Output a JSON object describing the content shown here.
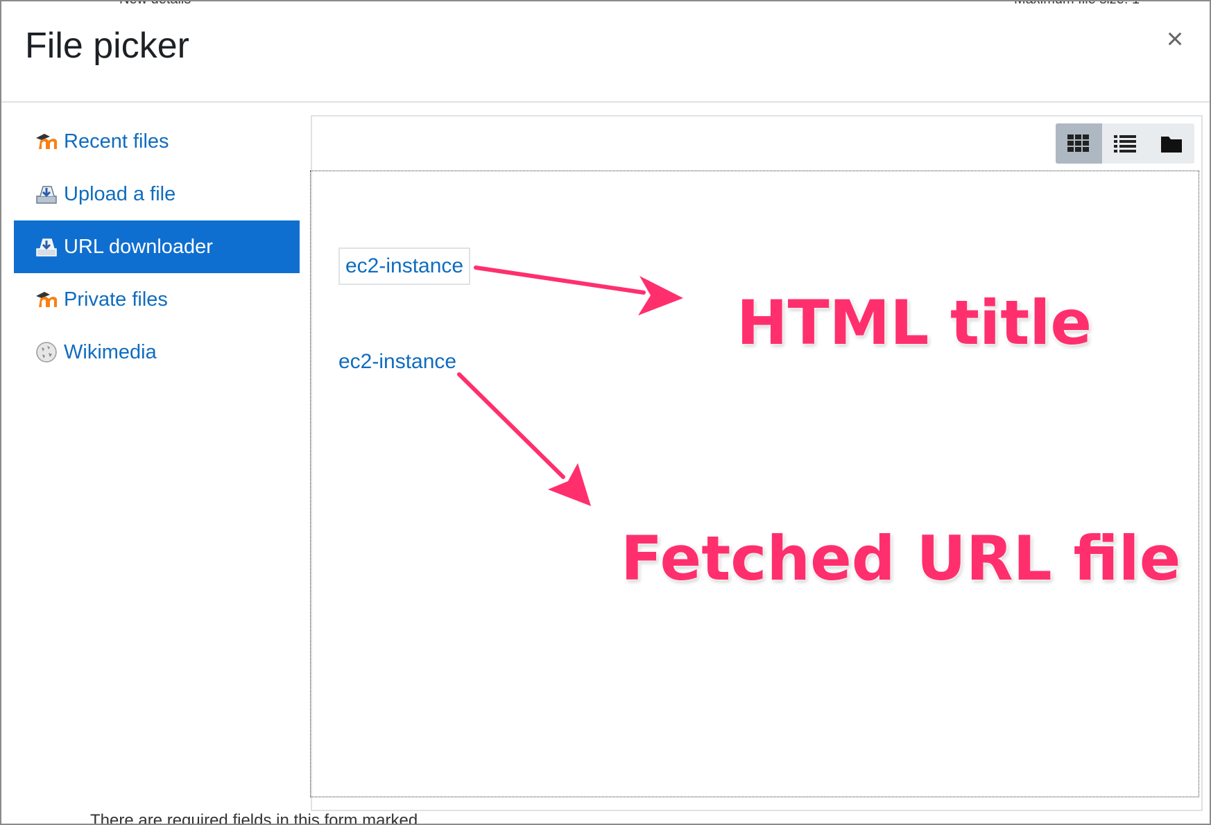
{
  "dialog": {
    "title": "File picker",
    "close_icon": "×"
  },
  "background": {
    "top_fragments": [
      "New details",
      "Maximum file size: 1"
    ],
    "bottom_text": "There are required fields in this form marked"
  },
  "sidebar": {
    "items": [
      {
        "label": "Recent files",
        "icon": "moodle-icon",
        "active": false
      },
      {
        "label": "Upload a file",
        "icon": "upload-icon",
        "active": false
      },
      {
        "label": "URL downloader",
        "icon": "download-icon",
        "active": true
      },
      {
        "label": "Private files",
        "icon": "moodle-icon",
        "active": false
      },
      {
        "label": "Wikimedia",
        "icon": "wikimedia-icon",
        "active": false
      }
    ]
  },
  "toolbar": {
    "views": [
      "icons-view",
      "list-view",
      "tree-view"
    ],
    "active_view": "icons-view"
  },
  "files": {
    "html_title": "ec2-instance",
    "file_link": "ec2-instance"
  },
  "annotations": {
    "label_1": "HTML title",
    "label_2": "Fetched URL file",
    "color": "#ff2f6e"
  }
}
